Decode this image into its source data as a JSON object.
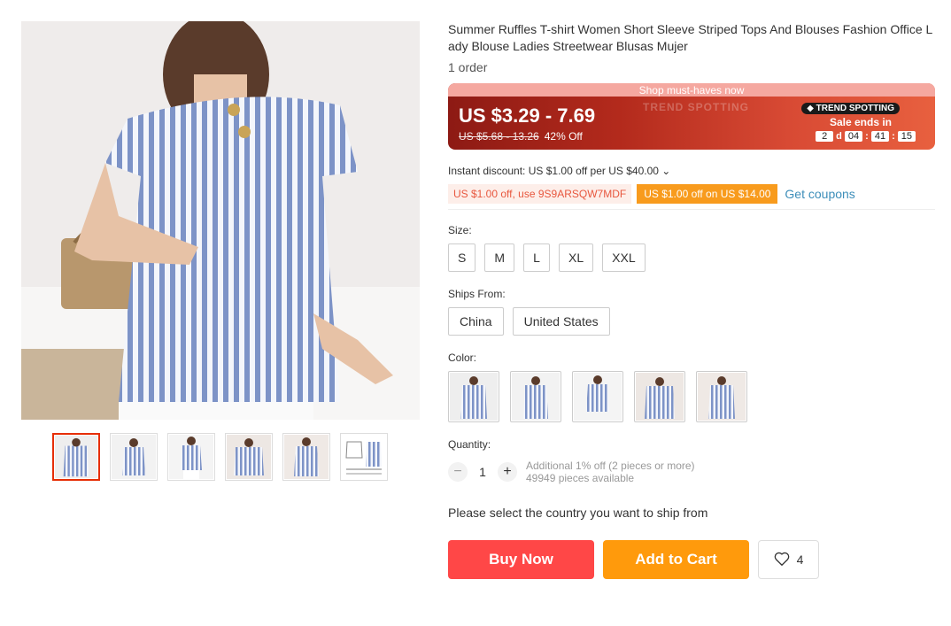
{
  "product": {
    "title": "Summer Ruffles T-shirt Women Short Sleeve Striped Tops And Blouses Fashion Office Lady Blouse Ladies Streetwear Blusas Mujer",
    "orders": "1 order"
  },
  "banner": {
    "header": "Shop must-haves now",
    "price": "US $3.29 - 7.69",
    "original_price": "US $5.68 - 13.26",
    "discount": "42% Off",
    "faint_text": "TREND SPOTTING",
    "tag": "TREND SPOTTING",
    "sale_label": "Sale ends in",
    "timer": {
      "days": "2",
      "d_label": "d",
      "hours": "04",
      "minutes": "41",
      "seconds": "15",
      "sep": ":"
    }
  },
  "discount": {
    "text": "Instant discount: US $1.00 off per US $40.00",
    "caret": "⌄"
  },
  "coupons": {
    "code": "US $1.00 off, use 9S9ARSQW7MDF",
    "store": "US $1.00 off on US $14.00",
    "get": "Get coupons"
  },
  "size": {
    "label": "Size:",
    "options": [
      "S",
      "M",
      "L",
      "XL",
      "XXL"
    ]
  },
  "ships_from": {
    "label": "Ships From:",
    "options": [
      "China",
      "United States"
    ]
  },
  "color": {
    "label": "Color:",
    "count": 5
  },
  "quantity": {
    "label": "Quantity:",
    "minus": "−",
    "plus": "+",
    "value": "1",
    "promo": "Additional 1% off (2 pieces or more)",
    "available": "49949 pieces available"
  },
  "ship_note": "Please select the country you want to ship from",
  "actions": {
    "buy": "Buy Now",
    "cart": "Add to Cart",
    "wishlist_count": "4"
  },
  "colors": {
    "accent": "#ff4747",
    "cart": "#ff9a0c",
    "link": "#3d8eb9",
    "active_thumb": "#e62e04"
  },
  "icons": [
    "heart-icon",
    "minus-icon",
    "plus-icon",
    "caret-down-icon"
  ]
}
